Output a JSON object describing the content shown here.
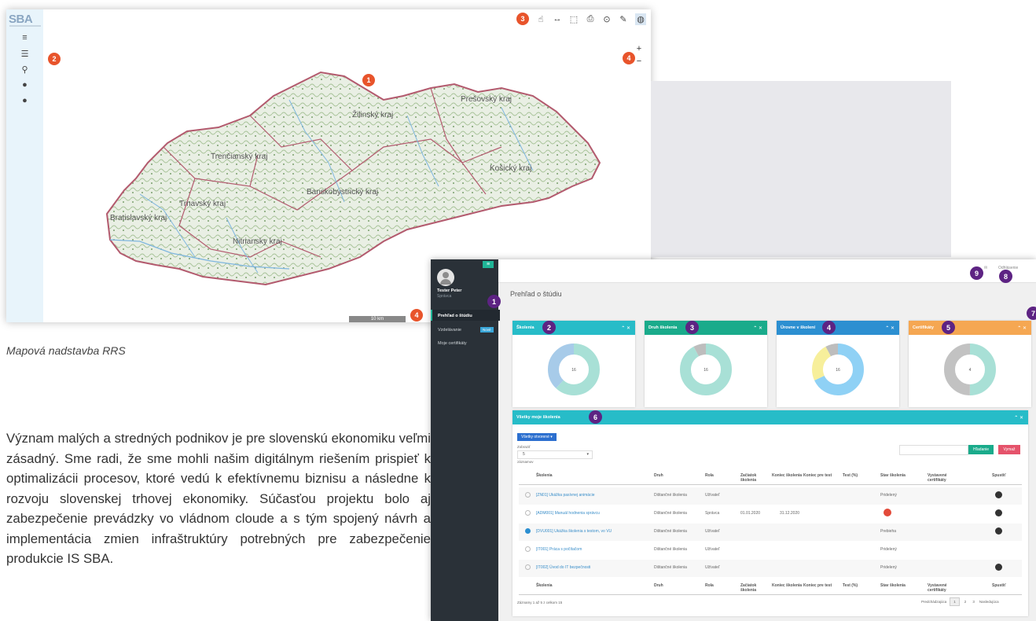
{
  "map": {
    "logo": "SBA",
    "toolbar_icons": [
      "hand-icon",
      "measure-icon",
      "area-icon",
      "print-icon",
      "locate-icon",
      "pencil-icon",
      "globe-icon"
    ],
    "side_icons": [
      "menu-icon",
      "list-icon",
      "search-icon",
      "info-icon",
      "help-icon"
    ],
    "zoom_in": "+",
    "zoom_out": "−",
    "scale_label": "10 km",
    "regions": [
      "Prešovský kraj",
      "Žilinský kraj",
      "Trenčianský kraj",
      "Košický kraj",
      "Trnavský kraj",
      "Banskobystrický kraj",
      "Bratislavský kraj",
      "Nitriansky kraj"
    ],
    "badges": [
      "1",
      "2",
      "3",
      "4",
      "4"
    ]
  },
  "caption": "Mapová nadstavba RRS",
  "paragraph": "Význam malých a stredných podnikov je pre slovenskú ekonomiku veľmi zásadný. Sme radi, že sme mohli našim digitálnym riešením prispieť k optimalizácii procesov, ktoré vedú k efektívnemu biznisu a následne k rozvoju slovenskej trhovej ekonomiky. Súčasťou projektu bolo aj zabezpečenie prevádzky vo vládnom cloude a s tým spojený návrh a implementácia zmien infraštruktúry potrebných pre zabezpečenie produkcie IS SBA.",
  "app": {
    "user_name": "Tester Peter",
    "user_role": "Správca",
    "nav": [
      "Prehľad o štúdiu",
      "Vzdelávanie",
      "Moje certifikáty"
    ],
    "nav_badge": "Nové",
    "logout": "Odhlásenie",
    "page_title": "Prehľad o štúdiu",
    "cards": [
      {
        "title": "Školenia",
        "center": "16",
        "color": "#27bcc8",
        "segments": [
          {
            "v": 62,
            "c": "#a8e0d6"
          },
          {
            "v": 38,
            "c": "#a7cbe9"
          }
        ]
      },
      {
        "title": "Druh školenia",
        "center": "16",
        "color": "#1aab8b",
        "segments": [
          {
            "v": 92,
            "c": "#a8e0d6"
          },
          {
            "v": 8,
            "c": "#bdbdbd"
          }
        ]
      },
      {
        "title": "Úrovne v školení",
        "center": "16",
        "color": "#2c8fd1",
        "segments": [
          {
            "v": 68,
            "c": "#8fd1f5"
          },
          {
            "v": 24,
            "c": "#f7ef9b"
          },
          {
            "v": 8,
            "c": "#bdbdbd"
          }
        ]
      },
      {
        "title": "Certifikáty",
        "center": "4",
        "color": "#f5a752",
        "segments": [
          {
            "v": 50,
            "c": "#a8e0d6"
          },
          {
            "v": 50,
            "c": "#c2c2c2"
          }
        ]
      }
    ],
    "table": {
      "title": "Všetky moje školenia",
      "filter_button": "Všetky otvorené",
      "show_label": "Zobraziť",
      "show_value": "5",
      "records_label": "záznamov",
      "search_button": "Hľadanie",
      "clear_button": "Vymaž",
      "headers": [
        "Školenia",
        "Druh",
        "Rola",
        "Začiatok školenia",
        "Koniec školenia",
        "Koniec pre test",
        "Test (%)",
        "Stav školenia",
        "Vystavené certifikáty",
        "Spustiť"
      ],
      "rows": [
        {
          "name": "[ZN01] Ukážka pasívnej animácie",
          "type": "Dištančné školenia",
          "role": "Užívateľ",
          "start": "",
          "end": "",
          "status": "Pridelený",
          "play": true
        },
        {
          "name": "[ADM001] Manuál hodnenia správcu",
          "type": "Dištančné školenia",
          "role": "Správca",
          "start": "01.01.2020",
          "end": "31.12.2020",
          "status": "",
          "play": true
        },
        {
          "name": "[DVU001] Ukážka školenia s testom, vo VU",
          "type": "Dištančné školenia",
          "role": "Užívateľ",
          "start": "",
          "end": "",
          "status": "Prebieha",
          "play": true
        },
        {
          "name": "[IT001] Práca s počítačom",
          "type": "Dištančné školenia",
          "role": "Užívateľ",
          "start": "",
          "end": "",
          "status": "Pridelený",
          "play": false
        },
        {
          "name": "[IT002] Úvod do IT bezpečnosti",
          "type": "Dištančné školenia",
          "role": "Užívateľ",
          "start": "",
          "end": "",
          "status": "Pridelený",
          "play": true
        }
      ],
      "footer_info": "Záznamy 1 až 5 z celkom 15",
      "pager": [
        "Predchádzajúca",
        "1",
        "2",
        "3",
        "Nasledujúca"
      ]
    },
    "badges": [
      "1",
      "2",
      "3",
      "4",
      "5",
      "6",
      "7",
      "8",
      "9"
    ]
  }
}
